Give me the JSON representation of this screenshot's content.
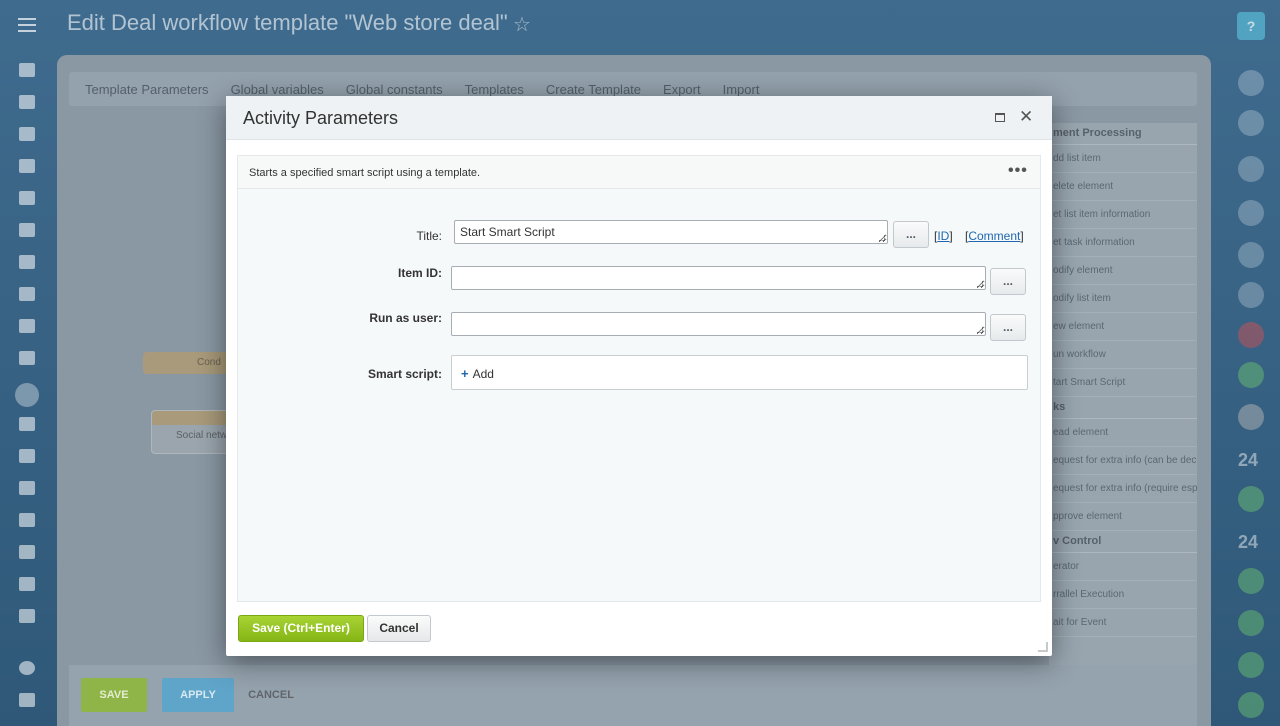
{
  "page": {
    "title": "Edit Deal workflow template \"Web store deal\"",
    "help_label": "?"
  },
  "toolbar": {
    "items": [
      "Template Parameters",
      "Global variables",
      "Global constants",
      "Templates",
      "Create Template",
      "Export",
      "Import"
    ]
  },
  "activity_panel": {
    "sections": [
      {
        "title": "ment Processing",
        "items": [
          "dd list item",
          "elete element",
          "et list item information",
          "et task information",
          "odify element",
          "odify list item",
          "ew element",
          "un workflow",
          "tart Smart Script"
        ]
      },
      {
        "title": "ks",
        "items": [
          "ead element",
          "equest for extra info (can be declined)",
          "equest for extra info (require esponse)",
          "pprove element"
        ]
      },
      {
        "title": "v Control",
        "items": [
          "erator",
          "rrallel Execution",
          "ait for Event"
        ]
      }
    ]
  },
  "designer": {
    "condition_node": "Cond",
    "social_node": "Social netw"
  },
  "bottom_bar": {
    "save": "SAVE",
    "apply": "APPLY",
    "cancel": "CANCEL"
  },
  "right_rail": {
    "counter_a": "24",
    "counter_b": "24"
  },
  "dialog": {
    "title": "Activity Parameters",
    "description": "Starts a specified smart script using a template.",
    "more_label": "•••",
    "fields": {
      "title_label": "Title:",
      "title_value": "Start Smart Script",
      "item_id_label": "Item ID:",
      "item_id_value": "",
      "run_as_label": "Run as user:",
      "run_as_value": "",
      "smart_script_label": "Smart script:"
    },
    "dots_label": "...",
    "id_link": "ID",
    "comment_link": "Comment",
    "add_label": "Add",
    "save_label": "Save (Ctrl+Enter)",
    "cancel_label": "Cancel"
  },
  "colors": {
    "save_button": "#8ebf1f",
    "link": "#2067b0",
    "dialog_header": "#eef2f4"
  },
  "icons": {
    "star": "star-icon",
    "close": "close-icon",
    "maximize": "maximize-icon",
    "more": "more-icon",
    "plus": "plus-icon"
  }
}
